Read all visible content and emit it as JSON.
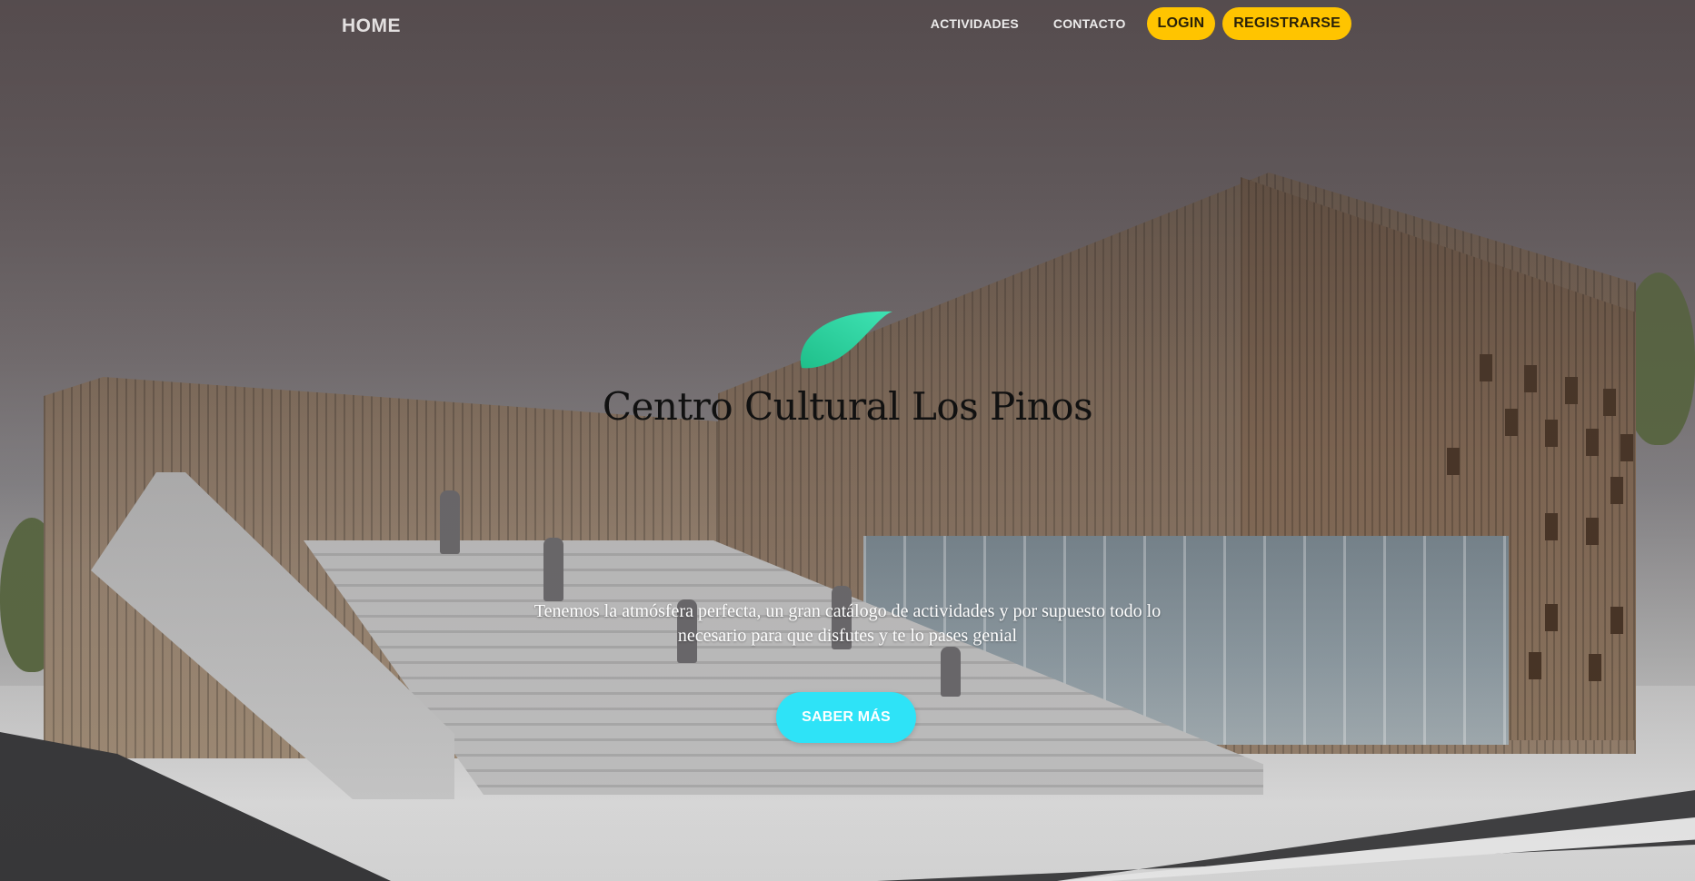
{
  "nav": {
    "brand": "HOME",
    "links": [
      "ACTIVIDADES",
      "CONTACTO"
    ],
    "login": "LOGIN",
    "register": "REGISTRARSE"
  },
  "hero": {
    "logo_icon": "leaf-icon",
    "title": "Centro Cultural Los Pinos",
    "subtitle": "Tenemos la atmósfera perfecta, un gran catálogo de actividades y por supuesto todo lo necesario para que disfutes y te lo pases genial",
    "cta": "SABER MÁS"
  },
  "colors": {
    "accent_yellow": "#ffc400",
    "cta_cyan": "#2ee3f7",
    "logo_green": "#29d4a0"
  }
}
